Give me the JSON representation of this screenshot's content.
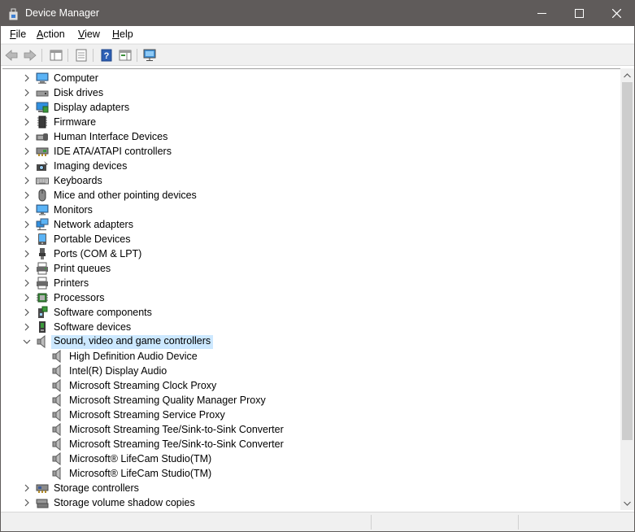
{
  "window": {
    "title": "Device Manager"
  },
  "menu": {
    "file": {
      "u": "F",
      "rest": "ile"
    },
    "action": {
      "u": "A",
      "rest": "ction"
    },
    "view": {
      "u": "V",
      "rest": "iew"
    },
    "help": {
      "u": "H",
      "rest": "elp"
    }
  },
  "tree": {
    "categories_top": [
      {
        "label": "Computer",
        "icon": "computer-icon"
      },
      {
        "label": "Disk drives",
        "icon": "disk-drive-icon"
      },
      {
        "label": "Display adapters",
        "icon": "display-adapter-icon"
      },
      {
        "label": "Firmware",
        "icon": "firmware-icon"
      },
      {
        "label": "Human Interface Devices",
        "icon": "hid-icon"
      },
      {
        "label": "IDE ATA/ATAPI controllers",
        "icon": "ide-controller-icon"
      },
      {
        "label": "Imaging devices",
        "icon": "camera-icon"
      },
      {
        "label": "Keyboards",
        "icon": "keyboard-icon"
      },
      {
        "label": "Mice and other pointing devices",
        "icon": "mouse-icon"
      },
      {
        "label": "Monitors",
        "icon": "monitor-icon"
      },
      {
        "label": "Network adapters",
        "icon": "network-adapter-icon"
      },
      {
        "label": "Portable Devices",
        "icon": "portable-device-icon"
      },
      {
        "label": "Ports (COM & LPT)",
        "icon": "port-icon"
      },
      {
        "label": "Print queues",
        "icon": "print-queue-icon"
      },
      {
        "label": "Printers",
        "icon": "printer-icon"
      },
      {
        "label": "Processors",
        "icon": "processor-icon"
      },
      {
        "label": "Software components",
        "icon": "software-component-icon"
      },
      {
        "label": "Software devices",
        "icon": "software-device-icon"
      }
    ],
    "expanded": {
      "label": "Sound, video and game controllers",
      "icon": "speaker-icon",
      "children": [
        "High Definition Audio Device",
        "Intel(R) Display Audio",
        "Microsoft Streaming Clock Proxy",
        "Microsoft Streaming Quality Manager Proxy",
        "Microsoft Streaming Service Proxy",
        "Microsoft Streaming Tee/Sink-to-Sink Converter",
        "Microsoft Streaming Tee/Sink-to-Sink Converter",
        "Microsoft® LifeCam Studio(TM)",
        "Microsoft® LifeCam Studio(TM)"
      ]
    },
    "categories_bottom": [
      {
        "label": "Storage controllers",
        "icon": "storage-controller-icon"
      },
      {
        "label": "Storage volume shadow copies",
        "icon": "shadow-copy-icon"
      }
    ]
  },
  "colors": {
    "titlebar": "#5f5b5a",
    "selection": "#cce8ff",
    "toolbar": "#f0f0f0"
  }
}
